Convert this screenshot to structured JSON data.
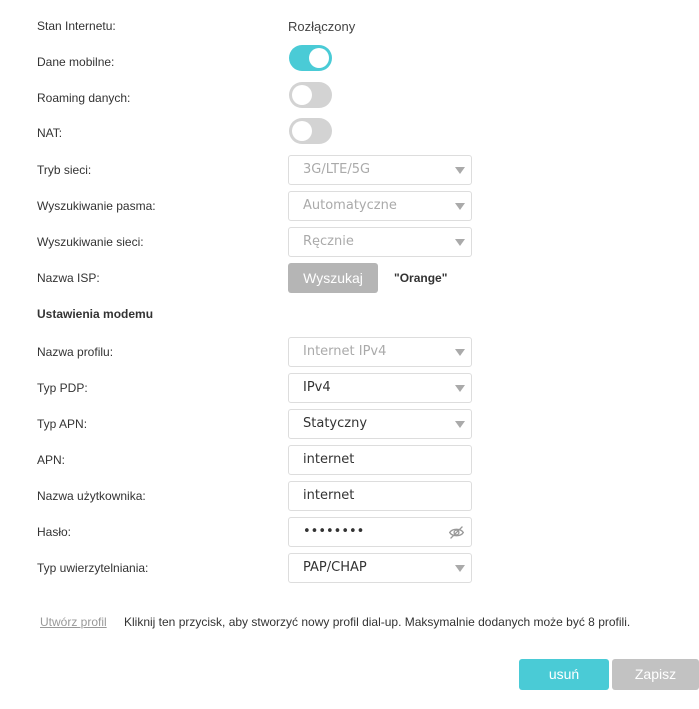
{
  "internet": {
    "label": "Stan Internetu:",
    "value": "Rozłączony"
  },
  "mobile_data": {
    "label": "Dane mobilne:",
    "state": "on"
  },
  "roaming": {
    "label": "Roaming danych:",
    "state": "off"
  },
  "nat": {
    "label": "NAT:",
    "state": "off"
  },
  "network_mode": {
    "label": "Tryb sieci:",
    "value": "3G/LTE/5G"
  },
  "band_search": {
    "label": "Wyszukiwanie pasma:",
    "value": "Automatyczne"
  },
  "network_search": {
    "label": "Wyszukiwanie sieci:",
    "value": "Ręcznie"
  },
  "isp": {
    "label": "Nazwa ISP:",
    "button": "Wyszukaj",
    "value": "\"Orange\""
  },
  "modem_section": {
    "title": "Ustawienia modemu"
  },
  "profile_name": {
    "label": "Nazwa profilu:",
    "value": "Internet IPv4"
  },
  "pdp_type": {
    "label": "Typ PDP:",
    "value": "IPv4"
  },
  "apn_type": {
    "label": "Typ APN:",
    "value": "Statyczny"
  },
  "apn": {
    "label": "APN:",
    "value": "internet"
  },
  "username": {
    "label": "Nazwa użytkownika:",
    "value": "internet"
  },
  "password": {
    "label": "Hasło:",
    "value": "••••••••"
  },
  "auth_type": {
    "label": "Typ uwierzytelniania:",
    "value": "PAP/CHAP"
  },
  "create_profile": {
    "link": "Utwórz profil",
    "hint": "Kliknij ten przycisk, aby stworzyć nowy profil dial-up. Maksymalnie dodanych może być 8 profili."
  },
  "actions": {
    "delete": "usuń",
    "save": "Zapisz"
  },
  "colors": {
    "accent": "#4acbd6",
    "toggle_off": "#d3d3d3",
    "button_gray": "#b5b5b5"
  }
}
